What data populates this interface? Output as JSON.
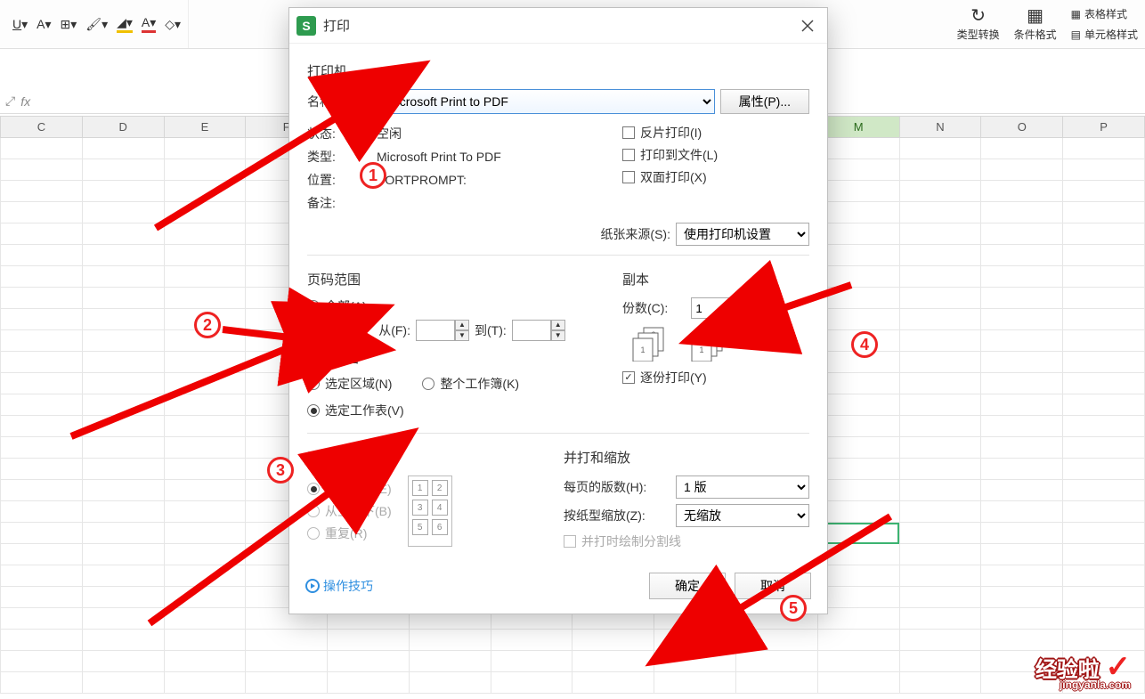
{
  "ribbon": {
    "right_buttons": [
      {
        "label": "类型转换",
        "icon": "↻"
      },
      {
        "label": "条件格式",
        "icon": "▦"
      },
      {
        "label": "表格样式",
        "icon": "▦"
      },
      {
        "label": "单元格样式",
        "icon": "▤"
      }
    ]
  },
  "columns": [
    "C",
    "D",
    "E",
    "F",
    "",
    "",
    "",
    "",
    "",
    "",
    "M",
    "N",
    "O",
    "P"
  ],
  "active_col_index": 10,
  "dialog": {
    "title": "打印",
    "printer_section": "打印机",
    "name_label": "名称(M):",
    "name_value": "Microsoft Print to PDF",
    "props_button": "属性(P)...",
    "status_label": "状态:",
    "status_value": "空闲",
    "type_label": "类型:",
    "type_value": "Microsoft Print To PDF",
    "where_label": "位置:",
    "where_value": "PORTPROMPT:",
    "comment_label": "备注:",
    "mirror_print": "反片打印(I)",
    "print_to_file": "打印到文件(L)",
    "duplex": "双面打印(X)",
    "paper_source_label": "纸张来源(S):",
    "paper_source_value": "使用打印机设置",
    "page_range_title": "页码范围",
    "range_all": "全部(A)",
    "range_pages": "页(G)",
    "from_label": "从(F):",
    "to_label": "到(T):",
    "content_title": "打印内容",
    "content_selection": "选定区域(N)",
    "content_workbook": "整个工作簿(K)",
    "content_sheet": "选定工作表(V)",
    "copies_title": "副本",
    "copies_label": "份数(C):",
    "copies_value": "1",
    "collate": "逐份打印(Y)",
    "order_title": "顺序",
    "order_lr": "从左到右(E)",
    "order_tb": "从上到下(B)",
    "order_repeat": "重复(R)",
    "merge_title": "并打和缩放",
    "per_page_label": "每页的版数(H):",
    "per_page_value": "1 版",
    "scale_label": "按纸型缩放(Z):",
    "scale_value": "无缩放",
    "draw_cut_lines": "并打时绘制分割线",
    "tips": "操作技巧",
    "ok": "确定",
    "cancel": "取消"
  },
  "badges": [
    "1",
    "2",
    "3",
    "4",
    "5"
  ],
  "watermark": {
    "main": "经验啦",
    "sub": "jingyanla.com",
    "check": "✓"
  }
}
